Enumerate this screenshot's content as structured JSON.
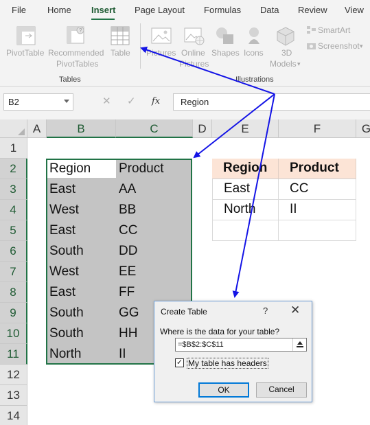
{
  "ribbon_tabs": [
    "File",
    "Home",
    "Insert",
    "Page Layout",
    "Formulas",
    "Data",
    "Review",
    "View"
  ],
  "active_tab": "Insert",
  "ribbon": {
    "pivottable": "PivotTable",
    "recommended_line1": "Recommended",
    "recommended_line2": "PivotTables",
    "table": "Table",
    "pictures": "Pictures",
    "online_pictures_line1": "Online",
    "online_pictures_line2": "Pictures",
    "shapes": "Shapes",
    "icons": "Icons",
    "models_line1": "3D",
    "models_line2": "Models",
    "smartart": "SmartArt",
    "screenshot": "Screenshot",
    "group_tables": "Tables",
    "group_illustrations": "Illustrations"
  },
  "formula_bar": {
    "name_box": "B2",
    "cancel_glyph": "✕",
    "enter_glyph": "✓",
    "fx_label": "fx",
    "formula": "Region"
  },
  "columns": [
    "A",
    "B",
    "C",
    "D",
    "E",
    "F",
    "G"
  ],
  "rows": [
    "1",
    "2",
    "3",
    "4",
    "5",
    "6",
    "7",
    "8",
    "9",
    "10",
    "11",
    "12",
    "13",
    "14"
  ],
  "source_data": {
    "headers": [
      "Region",
      "Product"
    ],
    "rows": [
      [
        "East",
        "AA"
      ],
      [
        "West",
        "BB"
      ],
      [
        "East",
        "CC"
      ],
      [
        "South",
        "DD"
      ],
      [
        "West",
        "EE"
      ],
      [
        "East",
        "FF"
      ],
      [
        "South",
        "GG"
      ],
      [
        "South",
        "HH"
      ],
      [
        "North",
        "II"
      ]
    ]
  },
  "result_table": {
    "headers": [
      "Region",
      "Product"
    ],
    "rows": [
      [
        "East",
        "CC"
      ],
      [
        "North",
        "II"
      ]
    ]
  },
  "create_table_dialog": {
    "title": "Create Table",
    "help": "?",
    "close": "✕",
    "question": "Where is the data for your table?",
    "range": "=$B$2:$C$11",
    "has_headers_label": "My table has headers",
    "has_headers_checked": true,
    "ok": "OK",
    "cancel": "Cancel"
  },
  "colors": {
    "accent_green": "#217346",
    "arrow_blue": "#1414e6",
    "header_fill": "#fce4d6",
    "selection_gray": "#c4c4c4"
  }
}
